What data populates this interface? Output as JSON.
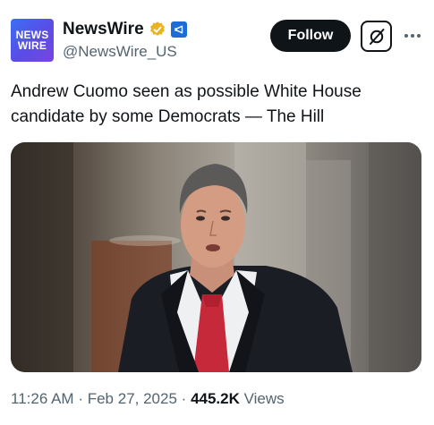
{
  "account": {
    "avatar_line1": "NEWS",
    "avatar_line2": "WIRE",
    "display_name": "NewsWire",
    "handle": "@NewsWire_US"
  },
  "actions": {
    "follow_label": "Follow"
  },
  "tweet": {
    "text": "Andrew Cuomo seen as possible White House candidate by some Democrats — The Hill"
  },
  "meta": {
    "time": "11:26 AM",
    "separator": "·",
    "date": "Feb 27, 2025",
    "views_count": "445.2K",
    "views_label": "Views"
  },
  "colors": {
    "text_primary": "#0f1419",
    "text_secondary": "#536471",
    "verified_gold": "#e8b422",
    "affiliate_blue": "#1d6bd6"
  },
  "icons": {
    "verified": "verified-badge-icon",
    "affiliate": "affiliate-badge-icon",
    "grok": "grok-icon",
    "more": "more-dots-icon"
  }
}
